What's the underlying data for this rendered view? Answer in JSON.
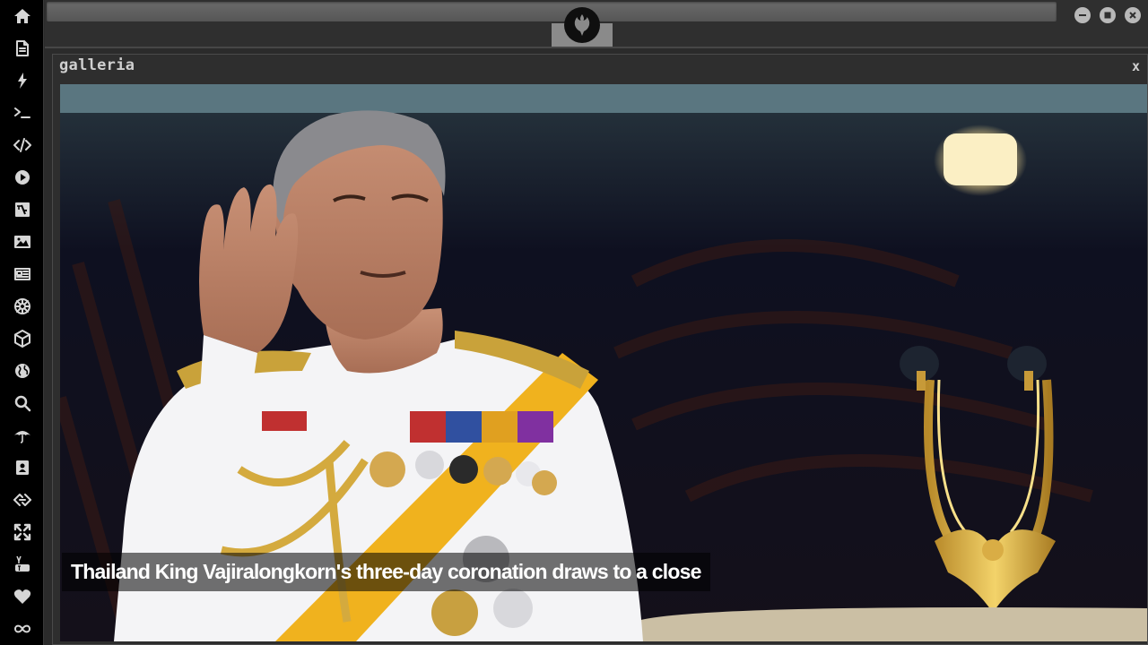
{
  "sidebar": {
    "items": [
      {
        "name": "home-icon"
      },
      {
        "name": "document-icon"
      },
      {
        "name": "lightning-icon"
      },
      {
        "name": "terminal-icon"
      },
      {
        "name": "code-icon"
      },
      {
        "name": "play-icon"
      },
      {
        "name": "translate-icon"
      },
      {
        "name": "image-icon"
      },
      {
        "name": "newspaper-icon"
      },
      {
        "name": "galactic-empire-icon"
      },
      {
        "name": "cube-icon"
      },
      {
        "name": "globe-icon"
      },
      {
        "name": "search-icon"
      },
      {
        "name": "umbrella-icon"
      },
      {
        "name": "contact-icon"
      },
      {
        "name": "codepen-icon"
      },
      {
        "name": "expand-icon"
      },
      {
        "name": "youtube-icon"
      },
      {
        "name": "heart-icon"
      },
      {
        "name": "infinity-icon"
      }
    ]
  },
  "window": {
    "title": "galleria",
    "close_label": "x"
  },
  "gallery": {
    "caption": "Thailand King Vajiralongkorn's three-day coronation draws to a close"
  },
  "colors": {
    "sidebar_bg": "#000000",
    "chrome_bg": "#2f2f2f",
    "icon": "#d6d6d6"
  }
}
